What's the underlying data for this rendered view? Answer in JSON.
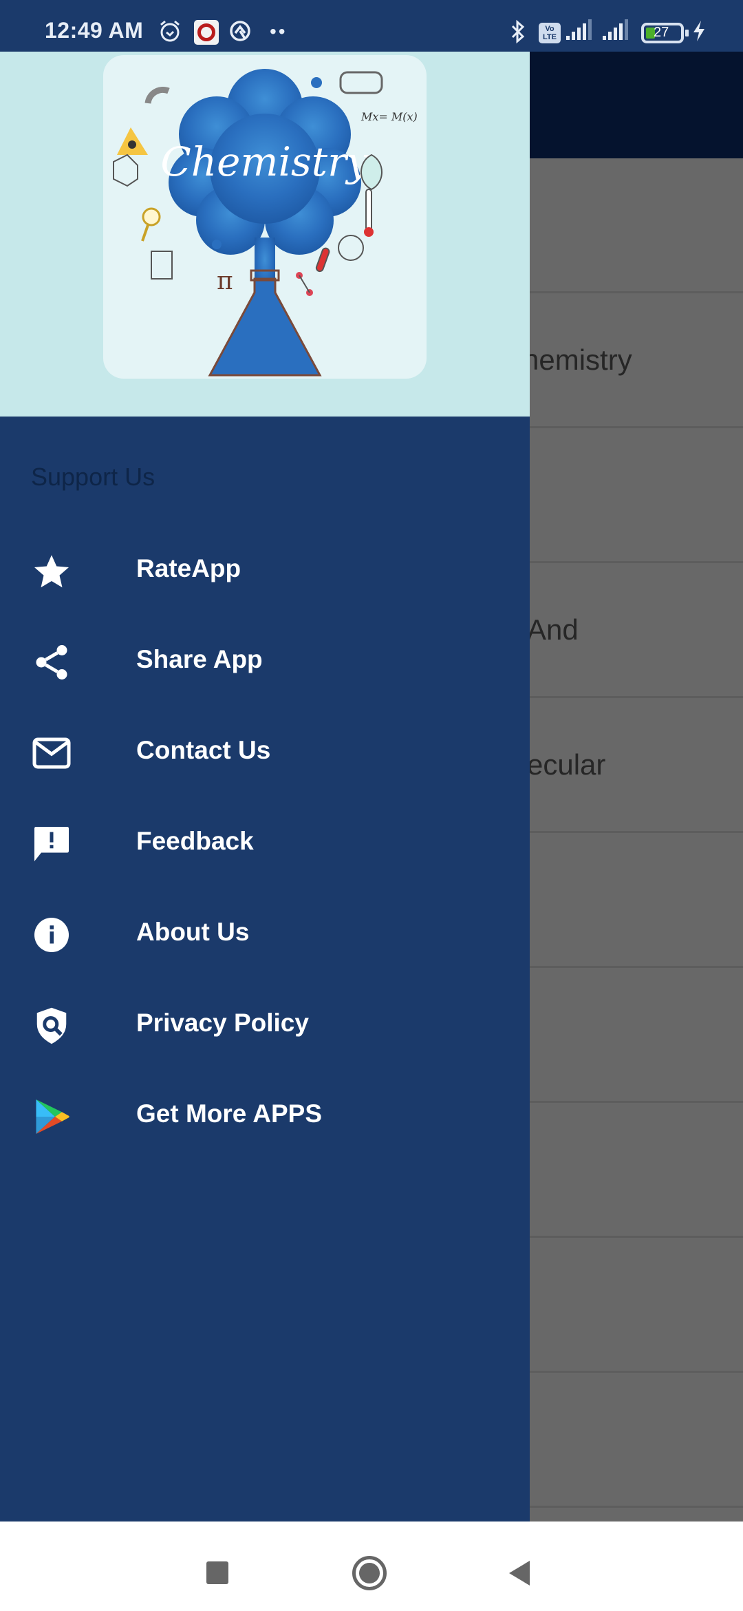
{
  "status_bar": {
    "time": "12:49 AM",
    "left_icons": [
      "alarm-icon",
      "screen-recorder-app-icon",
      "data-saver-icon",
      "more-notifications-dots"
    ],
    "more_indicator": "••",
    "right_icons": [
      "bluetooth-icon",
      "volte-icon",
      "signal-sim1-icon",
      "signal-sim2-icon",
      "battery-icon",
      "charging-icon"
    ],
    "volte_label": "Vo LTE",
    "battery_level": "27",
    "battery_fraction": 0.27,
    "colors": {
      "background": "#1b3a6b",
      "battery_fill": "#4caf2a"
    }
  },
  "drawer": {
    "header_image": {
      "title_text": "Chemistry",
      "description": "Watercolor chemistry illustration: blue smoke cloud from flask, surrounded by lab icons",
      "background": "#c6e8ea"
    },
    "section_title": "Support Us",
    "items": [
      {
        "label": "RateApp",
        "icon": "star-icon"
      },
      {
        "label": "Share App",
        "icon": "share-icon"
      },
      {
        "label": "Contact Us",
        "icon": "mail-icon"
      },
      {
        "label": "Feedback",
        "icon": "feedback-icon"
      },
      {
        "label": "About Us",
        "icon": "info-icon"
      },
      {
        "label": "Privacy Policy",
        "icon": "privacy-shield-icon"
      },
      {
        "label": "Get More APPS",
        "icon": "play-store-icon"
      }
    ],
    "colors": {
      "background": "#1b3a6b",
      "item_text": "#ffffff",
      "section_text": "#0e2548"
    }
  },
  "background_content": {
    "visible_fragments": [
      "",
      "hemistry",
      "",
      "And",
      "ecular",
      "",
      "",
      "",
      "",
      ""
    ]
  },
  "nav_bar": {
    "buttons": [
      "recents-button",
      "home-button",
      "back-button"
    ]
  }
}
